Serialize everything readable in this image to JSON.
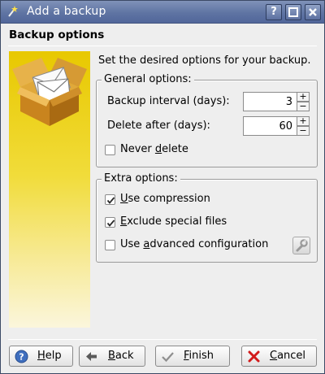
{
  "window": {
    "title": "Add a backup"
  },
  "page": {
    "heading": "Backup options",
    "intro": "Set the desired options for your backup."
  },
  "general": {
    "title": "General options:",
    "interval_label": "Backup interval (days):",
    "interval_value": "3",
    "delete_label": "Delete after (days):",
    "delete_value": "60",
    "never_delete": {
      "label_pre": "Never ",
      "label_key": "d",
      "label_post": "elete",
      "checked": false
    }
  },
  "extra": {
    "title": "Extra options:",
    "compression": {
      "label_key": "U",
      "label_post": "se compression",
      "checked": true
    },
    "exclude": {
      "label_key": "E",
      "label_post": "xclude special files",
      "checked": true
    },
    "advanced": {
      "label_pre": "Use ",
      "label_key": "a",
      "label_post": "dvanced configuration",
      "checked": false
    }
  },
  "buttons": {
    "help": {
      "key": "H",
      "rest": "elp"
    },
    "back": {
      "key": "B",
      "rest": "ack"
    },
    "finish": {
      "key": "F",
      "rest": "inish"
    },
    "cancel": {
      "key": "C",
      "rest": "ancel"
    }
  },
  "icons": {
    "app": "magic-wand-icon",
    "side": "package-mail-icon",
    "help": "help-icon",
    "back": "arrow-left-icon",
    "finish": "checkmark-icon",
    "cancel": "x-cancel-icon",
    "advanced": "wrench-icon"
  },
  "colors": {
    "titlebar": "#5f74a3",
    "side_panel": "#e8c800",
    "cancel_red": "#d21b1b",
    "help_blue": "#3f6fbf"
  }
}
